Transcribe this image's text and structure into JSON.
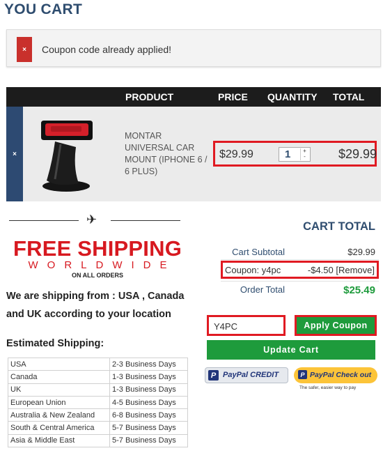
{
  "page_title": "YOU CART",
  "alert": {
    "icon": "×",
    "message": "Coupon code already applied!"
  },
  "cart": {
    "headers": {
      "product": "PRODUCT",
      "price": "PRICE",
      "quantity": "QUANTITY",
      "total": "TOTAL"
    },
    "item": {
      "remove_icon": "×",
      "name": "MONTAR UNIVERSAL CAR MOUNT (IPHONE 6 / 6 PLUS)",
      "price": "$29.99",
      "quantity": "1",
      "total": "$29.99"
    }
  },
  "shipping_banner": {
    "free_shipping": "FREE SHIPPING",
    "worldwide": "WORLDWIDE",
    "on_all_orders": "ON ALL ORDERS"
  },
  "shipping_info": "We are shipping from : USA , Canada and UK according to your location",
  "estimated_shipping": {
    "title": "Estimated Shipping:",
    "rows": [
      {
        "region": "USA",
        "time": "2-3 Business Days"
      },
      {
        "region": "Canada",
        "time": "1-3 Business Days"
      },
      {
        "region": "UK",
        "time": "1-3 Business Days"
      },
      {
        "region": "European Union",
        "time": "4-5 Business Days"
      },
      {
        "region": "Australia & New Zealand",
        "time": "6-8 Business Days"
      },
      {
        "region": "South & Central America",
        "time": "5-7 Business Days"
      },
      {
        "region": "Asia & Middle East",
        "time": "5-7 Business Days"
      }
    ]
  },
  "cart_total": {
    "title": "CART TOTAL",
    "subtotal_label": "Cart Subtotal",
    "subtotal_value": "$29.99",
    "coupon_label": "Coupon: y4pc",
    "coupon_value": "-$4.50 [Remove]",
    "order_total_label": "Order Total",
    "order_total_value": "$25.49"
  },
  "coupon_form": {
    "input_value": "Y4PC",
    "apply_label": "Apply Coupon",
    "update_label": "Update Cart"
  },
  "paypal": {
    "credit_label": "PayPal CREDIT",
    "checkout_brand": "PayPal",
    "checkout_label": "Check out",
    "tagline": "The safer, easier way to pay"
  },
  "colors": {
    "brand_blue": "#2f4d6f",
    "accent_red": "#e01a22",
    "button_green": "#1e9b3c",
    "paypal_yellow": "#fcc439"
  }
}
